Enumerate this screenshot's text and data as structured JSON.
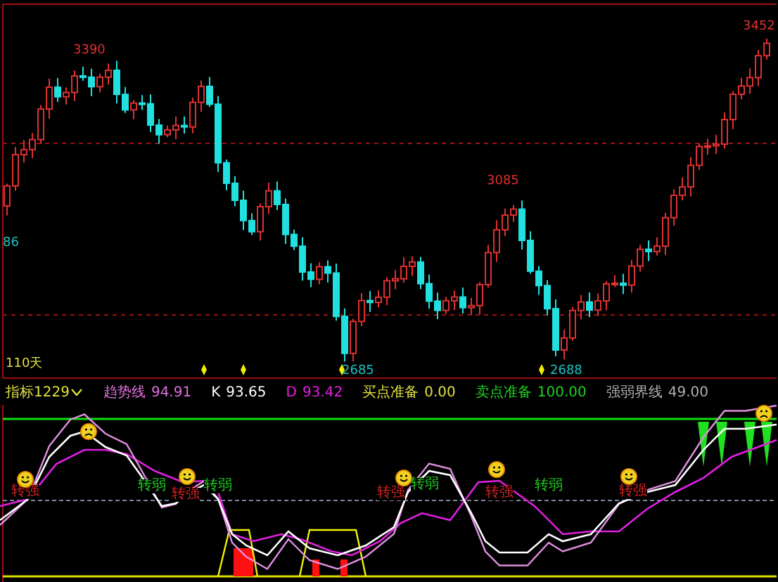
{
  "main_chart": {
    "price_labels": [
      {
        "text": "3390",
        "kind": "high"
      },
      {
        "text": "86",
        "kind": "low"
      },
      {
        "text": "3085",
        "kind": "high"
      },
      {
        "text": "3452",
        "kind": "high"
      },
      {
        "text": "2685",
        "kind": "low"
      },
      {
        "text": "2688",
        "kind": "low"
      }
    ],
    "period_label": "110天"
  },
  "indicator_bar": [
    {
      "kind": "selector",
      "label": "指标1229"
    },
    {
      "kind": "trend",
      "label": "趋势线",
      "value": "94.91"
    },
    {
      "kind": "k",
      "label": "K",
      "value": "93.65"
    },
    {
      "kind": "d",
      "label": "D",
      "value": "93.42"
    },
    {
      "kind": "buy",
      "label": "买点准备",
      "value": "0.00"
    },
    {
      "kind": "sell",
      "label": "卖点准备",
      "value": "100.00"
    },
    {
      "kind": "bound",
      "label": "强弱界线",
      "value": "49.00"
    }
  ],
  "signals": [
    {
      "text": "转强",
      "kind": "strong"
    },
    {
      "text": "转弱",
      "kind": "weak"
    },
    {
      "text": "转强",
      "kind": "strong"
    },
    {
      "text": "转弱",
      "kind": "weak"
    },
    {
      "text": "转强",
      "kind": "strong"
    },
    {
      "text": "转弱",
      "kind": "weak"
    },
    {
      "text": "转强",
      "kind": "strong"
    },
    {
      "text": "转弱",
      "kind": "weak"
    },
    {
      "text": "转强",
      "kind": "strong"
    }
  ],
  "faces": [
    {
      "kind": "smile"
    },
    {
      "kind": "frown"
    },
    {
      "kind": "smile"
    },
    {
      "kind": "smile"
    },
    {
      "kind": "smile"
    },
    {
      "kind": "smile"
    },
    {
      "kind": "frown"
    }
  ]
}
